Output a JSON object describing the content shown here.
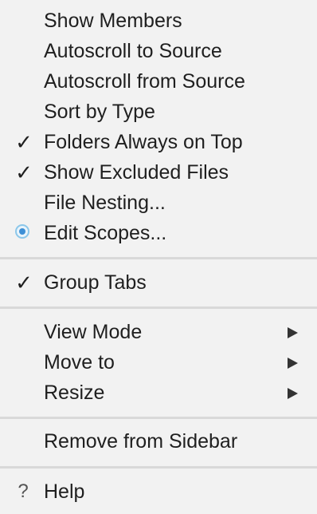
{
  "menu": {
    "items": [
      {
        "label": "Show Members"
      },
      {
        "label": "Autoscroll to Source"
      },
      {
        "label": "Autoscroll from Source"
      },
      {
        "label": "Sort by Type"
      },
      {
        "label": "Folders Always on Top",
        "checked": true
      },
      {
        "label": "Show Excluded Files",
        "checked": true
      },
      {
        "label": "File Nesting..."
      },
      {
        "label": "Edit Scopes...",
        "icon": "scopes-radio-icon"
      },
      {
        "label": "Group Tabs",
        "checked": true
      },
      {
        "label": "View Mode",
        "submenu": true
      },
      {
        "label": "Move to",
        "submenu": true
      },
      {
        "label": "Resize",
        "submenu": true
      },
      {
        "label": "Remove from Sidebar"
      },
      {
        "label": "Help",
        "icon": "question-icon"
      }
    ],
    "check_glyph": "✓",
    "help_glyph": "?"
  },
  "colors": {
    "background": "#f2f2f2",
    "separator": "#d9d9d9",
    "text": "#1f1f1f",
    "radio_accent": "#3d8fd6"
  }
}
